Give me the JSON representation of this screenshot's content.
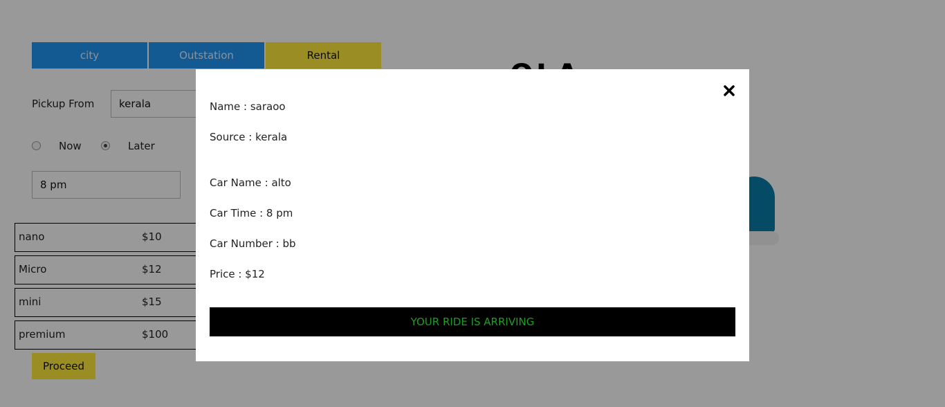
{
  "tabs": [
    {
      "label": "city"
    },
    {
      "label": "Outstation"
    },
    {
      "label": "Rental"
    }
  ],
  "pickup": {
    "label": "Pickup From",
    "value": "kerala"
  },
  "schedule": {
    "now_label": "Now",
    "later_label": "Later",
    "selected": "Later"
  },
  "time_value": "8 pm",
  "cars": [
    {
      "name": "nano",
      "price": "$10"
    },
    {
      "name": "Micro",
      "price": "$12"
    },
    {
      "name": "mini",
      "price": "$15"
    },
    {
      "name": "premium",
      "price": "$100"
    }
  ],
  "proceed_label": "Proceed",
  "logo": {
    "text": "OLA"
  },
  "modal": {
    "name": "Name : saraoo",
    "source": "Source : kerala",
    "car_name": "Car Name : alto",
    "car_time": "Car Time : 8 pm",
    "car_number": "Car Number : bb",
    "price": "Price : $12",
    "status": "YOUR RIDE IS ARRIVING"
  },
  "colors": {
    "tab_blue": "#2196f3",
    "tab_active": "#ffeb3b",
    "status_text": "#1f9e1f",
    "overlay": "rgba(0,0,0,0.4)"
  }
}
